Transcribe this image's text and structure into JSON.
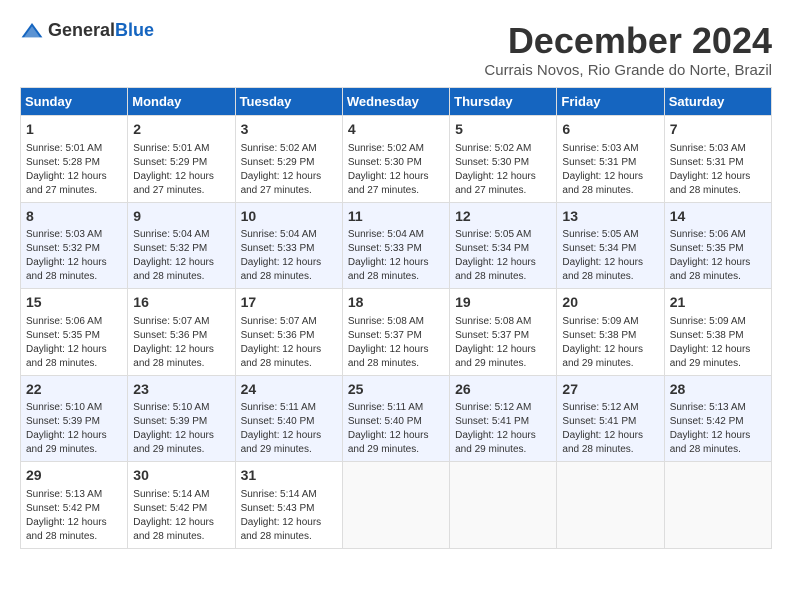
{
  "logo": {
    "text_general": "General",
    "text_blue": "Blue"
  },
  "title": "December 2024",
  "location": "Currais Novos, Rio Grande do Norte, Brazil",
  "days_of_week": [
    "Sunday",
    "Monday",
    "Tuesday",
    "Wednesday",
    "Thursday",
    "Friday",
    "Saturday"
  ],
  "weeks": [
    [
      {
        "day": "1",
        "sunrise": "5:01 AM",
        "sunset": "5:28 PM",
        "daylight": "12 hours and 27 minutes."
      },
      {
        "day": "2",
        "sunrise": "5:01 AM",
        "sunset": "5:29 PM",
        "daylight": "12 hours and 27 minutes."
      },
      {
        "day": "3",
        "sunrise": "5:02 AM",
        "sunset": "5:29 PM",
        "daylight": "12 hours and 27 minutes."
      },
      {
        "day": "4",
        "sunrise": "5:02 AM",
        "sunset": "5:30 PM",
        "daylight": "12 hours and 27 minutes."
      },
      {
        "day": "5",
        "sunrise": "5:02 AM",
        "sunset": "5:30 PM",
        "daylight": "12 hours and 27 minutes."
      },
      {
        "day": "6",
        "sunrise": "5:03 AM",
        "sunset": "5:31 PM",
        "daylight": "12 hours and 28 minutes."
      },
      {
        "day": "7",
        "sunrise": "5:03 AM",
        "sunset": "5:31 PM",
        "daylight": "12 hours and 28 minutes."
      }
    ],
    [
      {
        "day": "8",
        "sunrise": "5:03 AM",
        "sunset": "5:32 PM",
        "daylight": "12 hours and 28 minutes."
      },
      {
        "day": "9",
        "sunrise": "5:04 AM",
        "sunset": "5:32 PM",
        "daylight": "12 hours and 28 minutes."
      },
      {
        "day": "10",
        "sunrise": "5:04 AM",
        "sunset": "5:33 PM",
        "daylight": "12 hours and 28 minutes."
      },
      {
        "day": "11",
        "sunrise": "5:04 AM",
        "sunset": "5:33 PM",
        "daylight": "12 hours and 28 minutes."
      },
      {
        "day": "12",
        "sunrise": "5:05 AM",
        "sunset": "5:34 PM",
        "daylight": "12 hours and 28 minutes."
      },
      {
        "day": "13",
        "sunrise": "5:05 AM",
        "sunset": "5:34 PM",
        "daylight": "12 hours and 28 minutes."
      },
      {
        "day": "14",
        "sunrise": "5:06 AM",
        "sunset": "5:35 PM",
        "daylight": "12 hours and 28 minutes."
      }
    ],
    [
      {
        "day": "15",
        "sunrise": "5:06 AM",
        "sunset": "5:35 PM",
        "daylight": "12 hours and 28 minutes."
      },
      {
        "day": "16",
        "sunrise": "5:07 AM",
        "sunset": "5:36 PM",
        "daylight": "12 hours and 28 minutes."
      },
      {
        "day": "17",
        "sunrise": "5:07 AM",
        "sunset": "5:36 PM",
        "daylight": "12 hours and 28 minutes."
      },
      {
        "day": "18",
        "sunrise": "5:08 AM",
        "sunset": "5:37 PM",
        "daylight": "12 hours and 28 minutes."
      },
      {
        "day": "19",
        "sunrise": "5:08 AM",
        "sunset": "5:37 PM",
        "daylight": "12 hours and 29 minutes."
      },
      {
        "day": "20",
        "sunrise": "5:09 AM",
        "sunset": "5:38 PM",
        "daylight": "12 hours and 29 minutes."
      },
      {
        "day": "21",
        "sunrise": "5:09 AM",
        "sunset": "5:38 PM",
        "daylight": "12 hours and 29 minutes."
      }
    ],
    [
      {
        "day": "22",
        "sunrise": "5:10 AM",
        "sunset": "5:39 PM",
        "daylight": "12 hours and 29 minutes."
      },
      {
        "day": "23",
        "sunrise": "5:10 AM",
        "sunset": "5:39 PM",
        "daylight": "12 hours and 29 minutes."
      },
      {
        "day": "24",
        "sunrise": "5:11 AM",
        "sunset": "5:40 PM",
        "daylight": "12 hours and 29 minutes."
      },
      {
        "day": "25",
        "sunrise": "5:11 AM",
        "sunset": "5:40 PM",
        "daylight": "12 hours and 29 minutes."
      },
      {
        "day": "26",
        "sunrise": "5:12 AM",
        "sunset": "5:41 PM",
        "daylight": "12 hours and 29 minutes."
      },
      {
        "day": "27",
        "sunrise": "5:12 AM",
        "sunset": "5:41 PM",
        "daylight": "12 hours and 28 minutes."
      },
      {
        "day": "28",
        "sunrise": "5:13 AM",
        "sunset": "5:42 PM",
        "daylight": "12 hours and 28 minutes."
      }
    ],
    [
      {
        "day": "29",
        "sunrise": "5:13 AM",
        "sunset": "5:42 PM",
        "daylight": "12 hours and 28 minutes."
      },
      {
        "day": "30",
        "sunrise": "5:14 AM",
        "sunset": "5:42 PM",
        "daylight": "12 hours and 28 minutes."
      },
      {
        "day": "31",
        "sunrise": "5:14 AM",
        "sunset": "5:43 PM",
        "daylight": "12 hours and 28 minutes."
      },
      null,
      null,
      null,
      null
    ]
  ],
  "labels": {
    "sunrise": "Sunrise:",
    "sunset": "Sunset:",
    "daylight": "Daylight:"
  }
}
